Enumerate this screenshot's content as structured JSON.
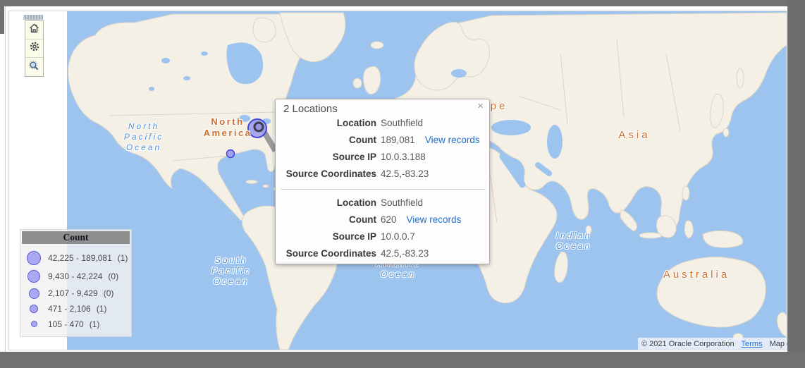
{
  "toolbar": {
    "buttons": [
      {
        "name": "home"
      },
      {
        "name": "settings"
      },
      {
        "name": "zoom-to-fit"
      }
    ]
  },
  "map": {
    "water_color": "#9dc4ef",
    "land_color": "#f4f0e6",
    "oceans": [
      {
        "id": "north-pacific-ocean",
        "lines": [
          "North",
          "Pacific",
          "Ocean"
        ]
      },
      {
        "id": "south-pacific-ocean",
        "lines": [
          "South",
          "Pacific",
          "Ocean"
        ]
      },
      {
        "id": "atlantic-ocean",
        "lines": [
          "Atlantic",
          "Ocean"
        ]
      },
      {
        "id": "indian-ocean",
        "lines": [
          "Indian",
          "Ocean"
        ]
      }
    ],
    "continents": [
      {
        "id": "north-america",
        "lines": [
          "North",
          "America"
        ]
      },
      {
        "id": "europe",
        "lines": [
          "Europe"
        ]
      },
      {
        "id": "asia",
        "lines": [
          "Asia"
        ]
      },
      {
        "id": "australia",
        "lines": [
          "Australia"
        ]
      }
    ],
    "marker_fill": "#a0a0ef",
    "marker_stroke": "#4646d8"
  },
  "popup": {
    "title": "2 Locations",
    "close": "×",
    "field_labels": {
      "location": "Location",
      "count": "Count",
      "source_ip": "Source IP",
      "source_coordinates": "Source Coordinates"
    },
    "link_label": "View records",
    "records": [
      {
        "location": "Southfield",
        "count": "189,081",
        "source_ip": "10.0.3.188",
        "source_coordinates": "42.5,-83.23"
      },
      {
        "location": "Southfield",
        "count": "620",
        "source_ip": "10.0.0.7",
        "source_coordinates": "42.5,-83.23"
      }
    ]
  },
  "legend": {
    "title": "Count",
    "items": [
      {
        "range": "42,225 - 189,081",
        "freq": "(1)"
      },
      {
        "range": "9,430 - 42,224",
        "freq": "(0)"
      },
      {
        "range": "2,107 - 9,429",
        "freq": "(0)"
      },
      {
        "range": "471 - 2,106",
        "freq": "(1)"
      },
      {
        "range": "105 - 470",
        "freq": "(1)"
      }
    ]
  },
  "attribution": {
    "copyright": "© 2021 Oracle Corporation",
    "terms": "Terms",
    "map_data": "Map data"
  }
}
